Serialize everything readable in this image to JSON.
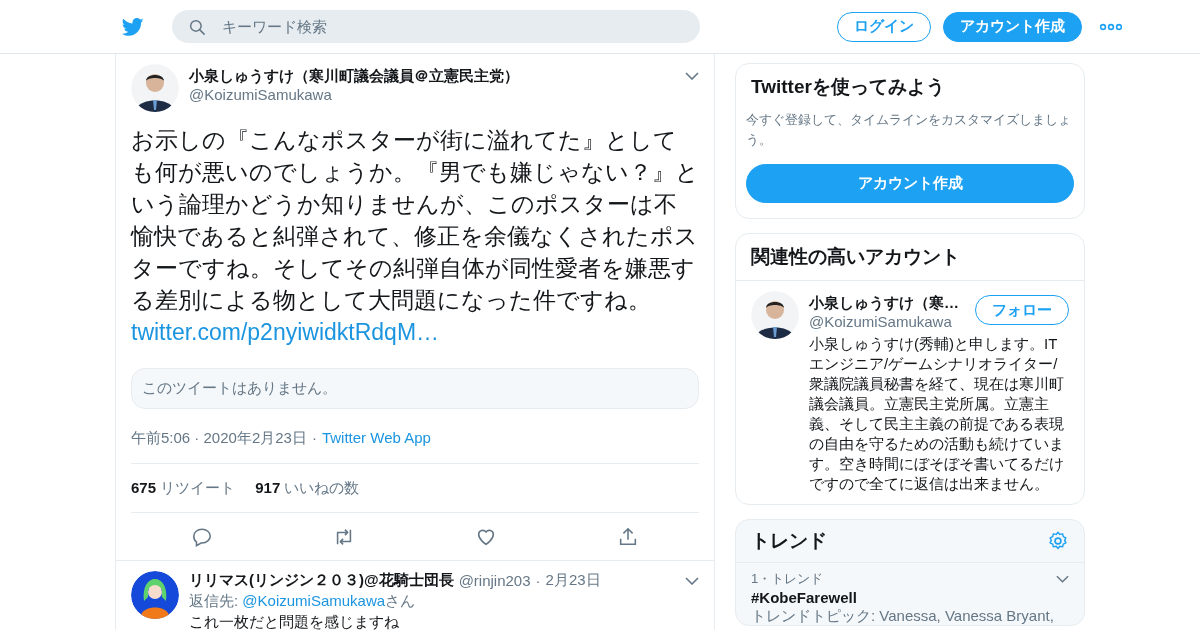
{
  "header": {
    "search": {
      "placeholder": "キーワード検索"
    },
    "login": "ログイン",
    "signup": "アカウント作成"
  },
  "tweet": {
    "name": "小泉しゅうすけ（寒川町議会議員＠立憲民主党）",
    "handle": "@KoizumiSamukawa",
    "text": "お示しの『こんなポスターが街に溢れてた』としても何が悪いのでしょうか。『男でも嫌じゃない？』という論理かどうか知りませんが、このポスターは不愉快であると糾弾されて、修正を余儀なくされたポスターですね。そしてその糾弾自体が同性愛者を嫌悪する差別による物として大問題になった件ですね。",
    "link": "twitter.com/p2nyiwidktRdqM…",
    "quote": "このツイートはありません。",
    "time": "午前5:06 · 2020年2月23日",
    "separator": "·",
    "source": "Twitter Web App",
    "stats": [
      {
        "count": "675",
        "label": "リツイート"
      },
      {
        "count": "917",
        "label": "いいねの数"
      }
    ]
  },
  "reply": {
    "name": "リリマス(リンジン２０３)@花騎士団長",
    "handle": "@rinjin203",
    "separator": "·",
    "date": "2月23日",
    "reply_prefix": "返信先: ",
    "reply_to": "@KoizumiSamukawa",
    "reply_suffix": "さん",
    "text": "これ一枚だと問題を感じますね"
  },
  "signup_card": {
    "title": "Twitterを使ってみよう",
    "text": "今すぐ登録して、タイムラインをカスタマイズしましょう。",
    "button": "アカウント作成"
  },
  "accounts_card": {
    "title": "関連性の高いアカウント",
    "accounts": [
      {
        "name": "小泉しゅうすけ（寒…",
        "handle": "@KoizumiSamukawa",
        "follow": "フォロー",
        "bio": "小泉しゅうすけ(秀輔)と申します。ITエンジニア/ゲームシナリオライター/衆議院議員秘書を経て、現在は寒川町議会議員。立憲民主党所属。立憲主義、そして民主主義の前提である表現の自由を守るための活動も続けています。空き時間にぼそぼそ書いてるだけですので全てに返信は出来ません。"
      }
    ]
  },
  "trends": {
    "title": "トレンド",
    "items": [
      {
        "meta": "1・トレンド",
        "name": "#KobeFarewell",
        "topics": "トレンドトピック: Vanessa, Vanessa Bryant,"
      }
    ]
  }
}
